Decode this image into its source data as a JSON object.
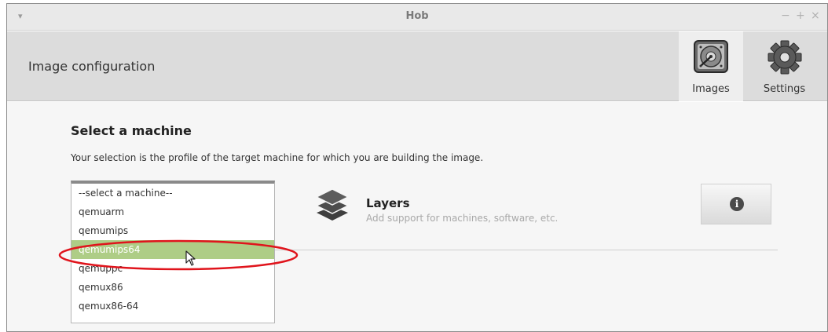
{
  "window": {
    "title": "Hob",
    "menu_glyph": "▾",
    "controls": {
      "minimize": "−",
      "maximize": "+",
      "close": "×"
    }
  },
  "header": {
    "title": "Image configuration",
    "tools": [
      {
        "label": "Images",
        "icon": "hard-disk-icon"
      },
      {
        "label": "Settings",
        "icon": "gear-icon"
      }
    ]
  },
  "content": {
    "section_title": "Select a machine",
    "section_description": "Your selection is the profile of the target machine for which you are building the image.",
    "machines": [
      "--select a machine--",
      "qemuarm",
      "qemumips",
      "qemumips64",
      "qemuppc",
      "qemux86",
      "qemux86-64"
    ],
    "selected_machine": "qemumips64",
    "layers": {
      "title": "Layers",
      "description": "Add support for machines, software, etc.",
      "icon": "layers-icon"
    },
    "info_button": {
      "glyph": "i",
      "icon": "info-icon"
    }
  },
  "colors": {
    "selection": "#aecd86",
    "annotation": "#e0141c",
    "header_bg": "#dcdcdc"
  }
}
